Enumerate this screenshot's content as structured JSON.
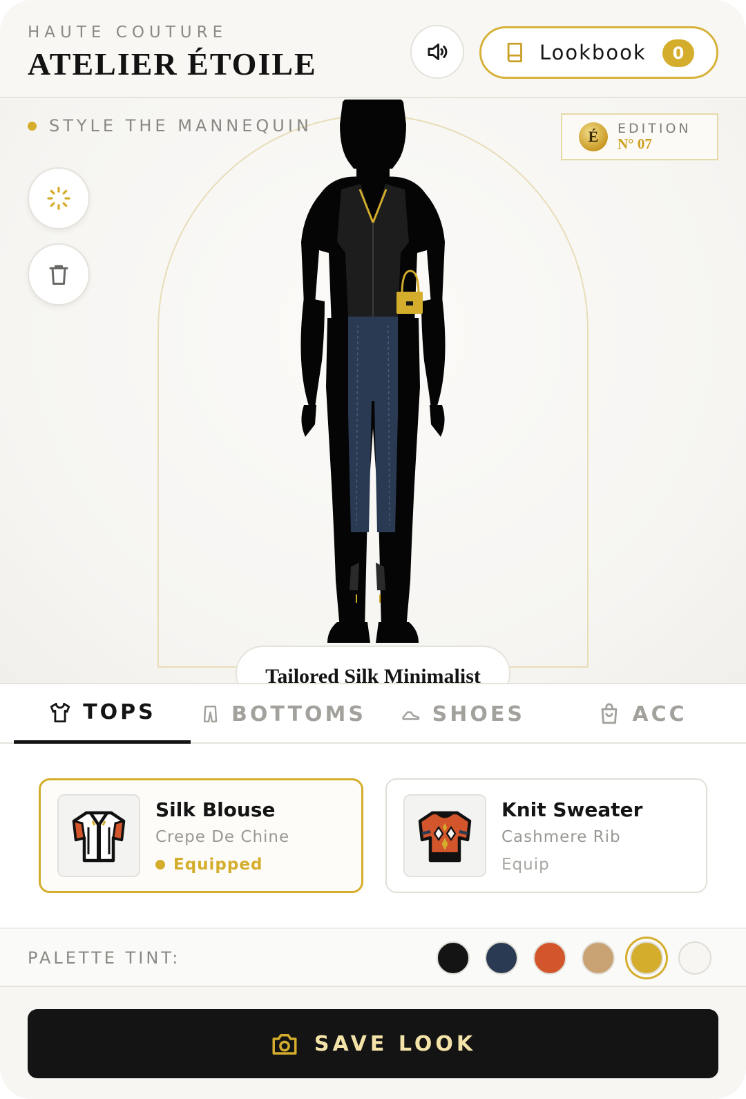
{
  "header": {
    "subtitle": "HAUTE COUTURE",
    "title": "ATELIER ÉTOILE",
    "sound_icon": "speaker-icon",
    "lookbook_label": "Lookbook",
    "lookbook_count": "0"
  },
  "stage": {
    "label": "STYLE THE MANNEQUIN",
    "edition_seal": "É",
    "edition_word": "EDITION",
    "edition_number": "N° 07",
    "look_name": "Tailored Silk Minimalist",
    "tools": [
      "sparkle-icon",
      "trash-icon"
    ]
  },
  "tabs": [
    {
      "label": "TOPS",
      "icon": "shirt-icon",
      "active": true
    },
    {
      "label": "BOTTOMS",
      "icon": "pants-icon",
      "active": false
    },
    {
      "label": "SHOES",
      "icon": "shoe-icon",
      "active": false
    },
    {
      "label": "ACC",
      "icon": "bag-icon",
      "active": false
    }
  ],
  "items": [
    {
      "name": "Silk Blouse",
      "fabric": "Crepe De Chine",
      "status": "Equipped",
      "equipped": true
    },
    {
      "name": "Knit Sweater",
      "fabric": "Cashmere Rib",
      "status": "Equip",
      "equipped": false
    }
  ],
  "palette": {
    "label": "PALETTE TINT:",
    "colors": [
      "#141414",
      "#2a3a52",
      "#d2552b",
      "#c9a274",
      "#d4ad2c",
      "#f7f6f2"
    ],
    "selected_index": 4
  },
  "save_label": "SAVE LOOK",
  "colors": {
    "accent": "#d4ad2c",
    "ink": "#141414"
  }
}
